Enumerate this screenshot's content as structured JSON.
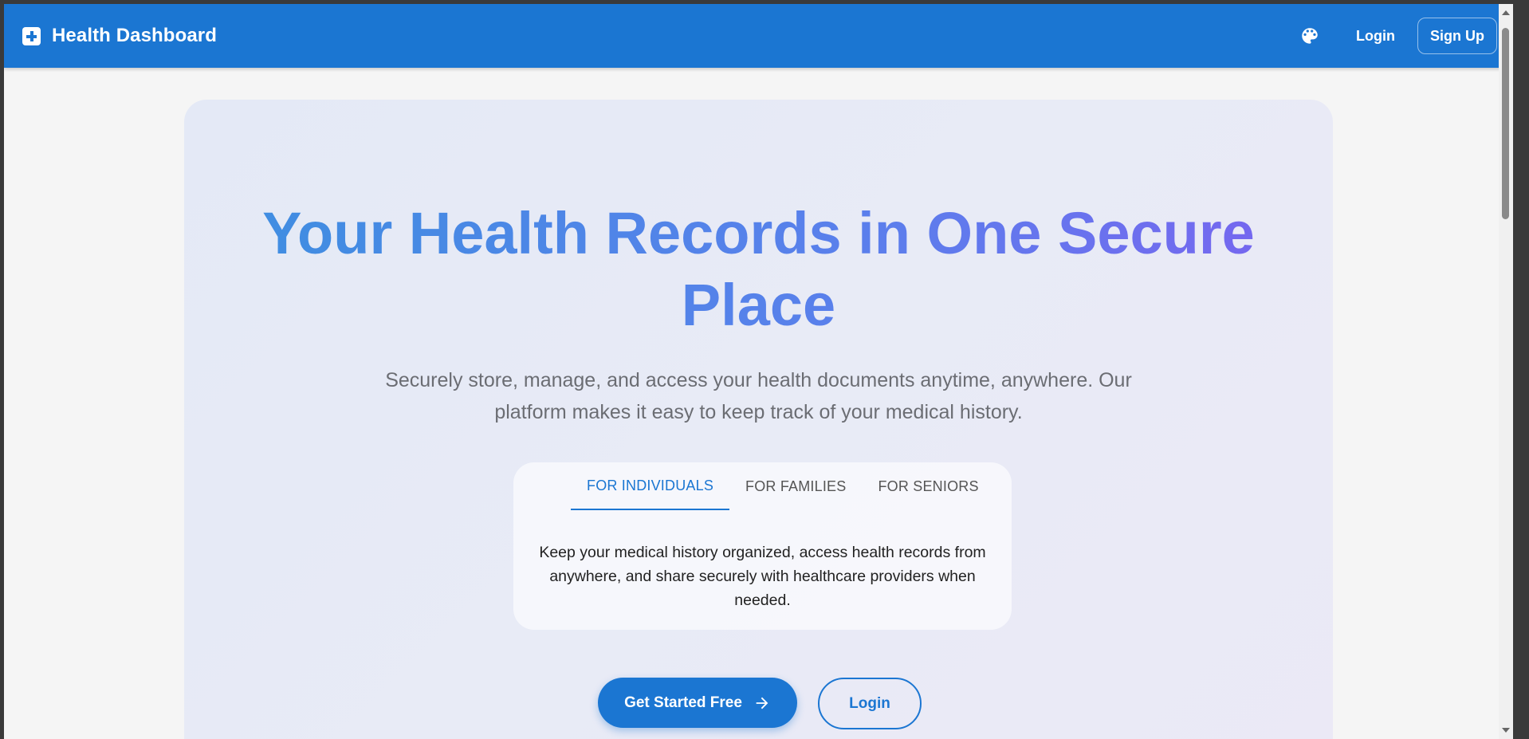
{
  "header": {
    "title": "Health Dashboard",
    "brand_icon": "medical-cross-icon",
    "theme_icon": "palette-icon",
    "login_label": "Login",
    "signup_label": "Sign Up"
  },
  "hero": {
    "title": "Your Health Records in One Secure Place",
    "subtitle": "Securely store, manage, and access your health documents anytime, anywhere. Our platform makes it easy to keep track of your medical history.",
    "tabs": [
      {
        "label": "FOR INDIVIDUALS",
        "active": true
      },
      {
        "label": "FOR FAMILIES",
        "active": false
      },
      {
        "label": "FOR SENIORS",
        "active": false
      }
    ],
    "tab_description": "Keep your medical history organized, access health records from anywhere, and share securely with healthcare providers when needed.",
    "primary_cta": "Get Started Free",
    "primary_cta_icon": "arrow-right-icon",
    "secondary_cta": "Login"
  },
  "colors": {
    "primary": "#1b76d2",
    "background": "#f5f5f5",
    "title_gradient_start": "#3d8fe0",
    "title_gradient_end": "#7a63f0"
  }
}
